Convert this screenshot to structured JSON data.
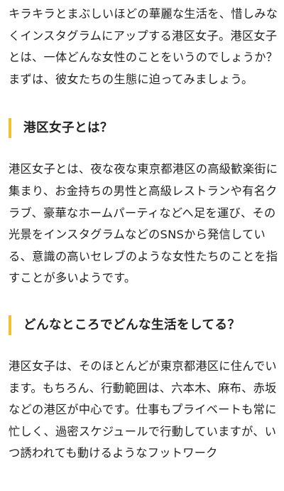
{
  "article": {
    "intro": "キラキラとまぶしいほどの華麗な生活を、惜しみなくインスタグラムにアップする港区女子。港区女子とは、一体どんな女性のことをいうのでしょうか？ まずは、彼女たちの生態に迫ってみましょう。",
    "section1": {
      "heading": "港区女子とは？",
      "body": "港区女子とは、夜な夜な東京都港区の高級歓楽街に集まり、お金持ちの男性と高級レストランや有名クラブ、豪華なホームパーティなどへ足を運び、その光景をインスタグラムなどのSNSから発信している、意識の高いセレブのような女性たちのことを指すことが多いようです。"
    },
    "section2": {
      "heading": "どんなところでどんな生活をしてる？",
      "body": "港区女子は、そのほとんどが東京都港区に住んでいます。もちろん、行動範囲は、六本木、麻布、赤坂などの港区が中心です。仕事もプライベートも常に忙しく、過密スケジュールで行動していますが、いつ誘われても動けるようなフットワーク"
    },
    "accent_color": "#f2c12e"
  }
}
